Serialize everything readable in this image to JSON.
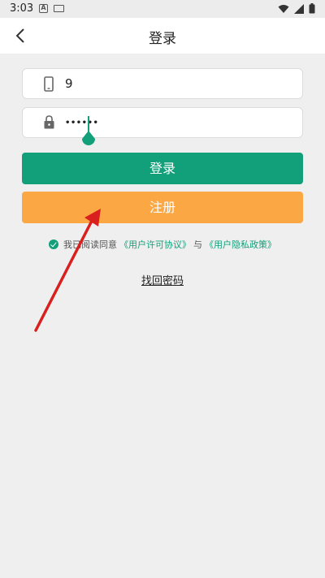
{
  "status_bar": {
    "time": "3:03",
    "a_icon_letter": "A"
  },
  "header": {
    "title": "登录"
  },
  "phone_field": {
    "value": "9",
    "icon": "phone-icon"
  },
  "password_field": {
    "masked_value": "••••••",
    "icon": "lock-icon"
  },
  "buttons": {
    "login_label": "登录",
    "register_label": "注册"
  },
  "agreement": {
    "prefix": "我已阅读同意",
    "user_agreement": "《用户许可协议》",
    "conjunction": "与",
    "privacy_policy": "《用户隐私政策》"
  },
  "forgot_password": "找回密码",
  "colors": {
    "primary": "#12a07a",
    "secondary": "#fba844",
    "background": "#efefef",
    "annotation_arrow": "#d9201f"
  }
}
